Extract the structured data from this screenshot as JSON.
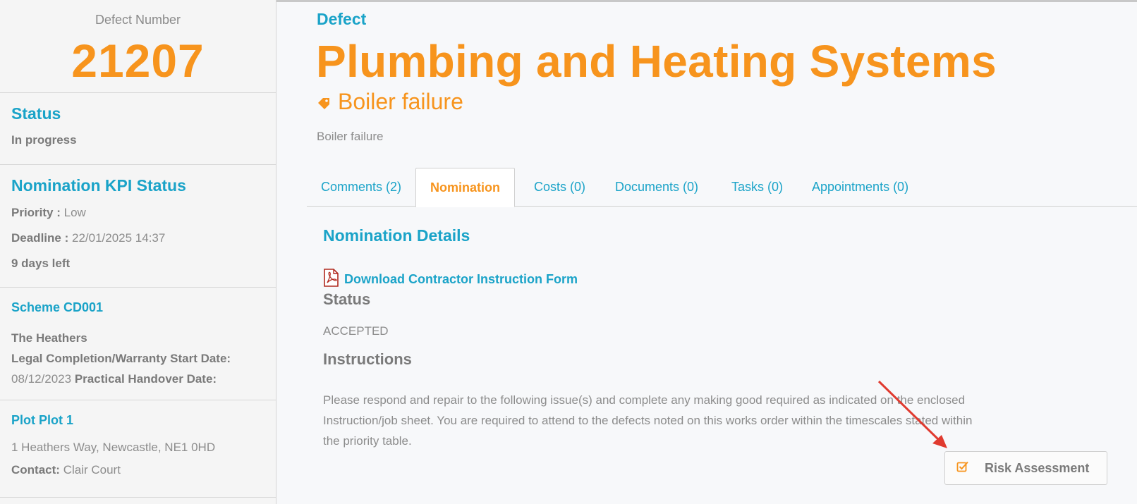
{
  "sidebar": {
    "defect_number_label": "Defect Number",
    "defect_number": "21207",
    "status_heading": "Status",
    "status_value": "In progress",
    "kpi_heading": "Nomination KPI Status",
    "priority_label": "Priority :",
    "priority_value": "Low",
    "deadline_label": "Deadline :",
    "deadline_value": "22/01/2025 14:37",
    "days_left": "9 days left",
    "scheme_link": "Scheme CD001",
    "scheme_name": "The Heathers",
    "legal_completion_label": "Legal Completion/Warranty Start Date:",
    "legal_completion_value": "08/12/2023",
    "practical_handover_label": "Practical Handover Date:",
    "plot_link": "Plot Plot 1",
    "address": "1 Heathers Way, Newcastle, NE1 0HD",
    "contact_label": "Contact:",
    "contact_value": "Clair Court"
  },
  "header": {
    "breadcrumb": "Defect",
    "title": "Plumbing and Heating Systems",
    "subtitle": "Boiler failure",
    "description": "Boiler failure"
  },
  "tabs": [
    {
      "label": "Comments (2)"
    },
    {
      "label": "Nomination",
      "active": true
    },
    {
      "label": "Costs (0)"
    },
    {
      "label": "Documents (0)"
    },
    {
      "label": "Tasks (0)"
    },
    {
      "label": "Appointments (0)"
    }
  ],
  "nomination": {
    "heading": "Nomination Details",
    "download_label": "Download Contractor Instruction Form",
    "status_heading": "Status",
    "status_value": "ACCEPTED",
    "instructions_heading": "Instructions",
    "instructions_line1": "Please respond and repair to the following issue(s) and complete any making good required as indicated on the enclosed",
    "instructions_line2": "Instruction/job sheet. You are required to attend to the defects noted on this works order within the timescales stated within",
    "instructions_line3": "the priority table.",
    "risk_button_label": "Risk Assessment"
  },
  "colors": {
    "accent_blue": "#1aa3c8",
    "accent_orange": "#f7941d",
    "annotation_red": "#e03a2f"
  },
  "icons": {
    "tag": "tag-icon",
    "pdf": "pdf-icon",
    "checkbox": "checkbox-icon",
    "annotation": "red-arrow-annotation"
  }
}
